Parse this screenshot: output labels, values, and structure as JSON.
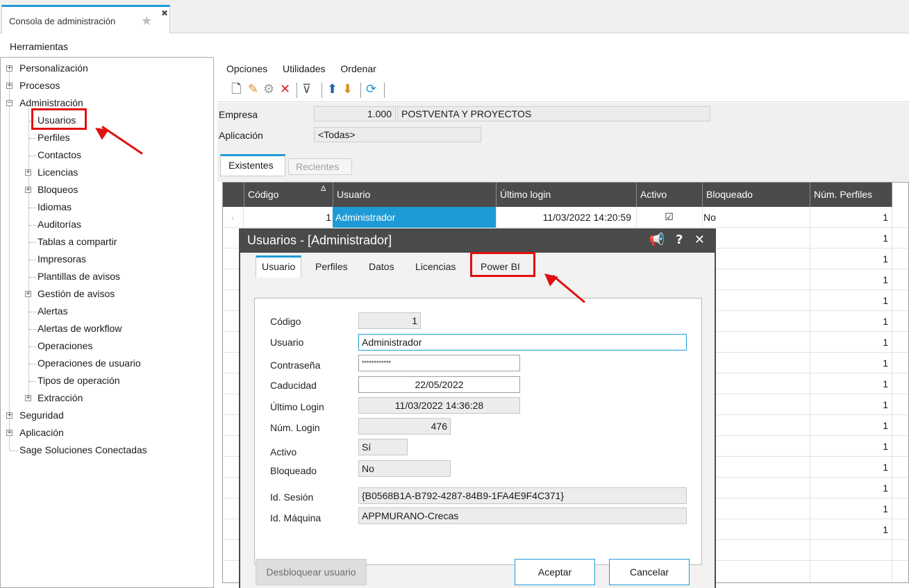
{
  "window_tab": {
    "title": "Consola de administración"
  },
  "top_menu": {
    "herramientas": "Herramientas"
  },
  "tree": {
    "items": [
      "Personalización",
      "Procesos",
      "Administración",
      "Usuarios",
      "Perfiles",
      "Contactos",
      "Licencias",
      "Bloqueos",
      "Idiomas",
      "Auditorías",
      "Tablas a compartir",
      "Impresoras",
      "Plantillas de avisos",
      "Gestión de avisos",
      "Alertas",
      "Alertas de workflow",
      "Operaciones",
      "Operaciones de usuario",
      "Tipos de operación",
      "Extracción",
      "Seguridad",
      "Aplicación",
      "Sage Soluciones Conectadas"
    ]
  },
  "main_menu": {
    "opciones": "Opciones",
    "utilidades": "Utilidades",
    "ordenar": "Ordenar"
  },
  "filters": {
    "empresa_label": "Empresa",
    "empresa_code": "1.000",
    "empresa_name": "POSTVENTA Y PROYECTOS",
    "aplicacion_label": "Aplicación",
    "aplicacion_value": "<Todas>"
  },
  "list_tabs": {
    "existentes": "Existentes",
    "recientes": "Recientes"
  },
  "grid": {
    "columns": [
      "Código",
      "Usuario",
      "Último login",
      "Activo",
      "Bloqueado",
      "Núm. Perfiles"
    ],
    "sort_indicator": "Δ",
    "first_row": {
      "codigo": "1",
      "usuario": "Administrador",
      "ultimo_login": "11/03/2022 14:20:59",
      "activo": "☑",
      "bloqueado": "No",
      "num_perfiles": "1"
    },
    "extra_perfiles": [
      "1",
      "1",
      "1",
      "1",
      "1",
      "1",
      "1",
      "1",
      "1",
      "1",
      "1",
      "1",
      "1",
      "1",
      "1"
    ]
  },
  "dialog": {
    "title": "Usuarios - [Administrador]",
    "tabs": [
      "Usuario",
      "Perfiles",
      "Datos",
      "Licencias",
      "Power BI"
    ],
    "labels": {
      "codigo": "Código",
      "usuario": "Usuario",
      "contrasena": "Contraseña",
      "caducidad": "Caducidad",
      "ultimo_login": "Último Login",
      "num_login": "Núm. Login",
      "activo": "Activo",
      "bloqueado": "Bloqueado",
      "id_sesion": "Id. Sesión",
      "id_maquina": "Id. Máquina"
    },
    "values": {
      "codigo": "1",
      "usuario": "Administrador",
      "contrasena": "************",
      "caducidad": "22/05/2022",
      "ultimo_login": "11/03/2022 14:36:28",
      "num_login": "476",
      "activo": "Sí",
      "bloqueado": "No",
      "id_sesion": "{B0568B1A-B792-4287-84B9-1FA4E9F4C371}",
      "id_maquina": "APPMURANO-Crecas"
    },
    "buttons": {
      "desbloquear": "Desbloquear usuario",
      "aceptar": "Aceptar",
      "cancelar": "Cancelar"
    }
  },
  "colors": {
    "accent": "#1e9bd7",
    "highlight_red": "#e01010",
    "grid_header": "#4b4b4b",
    "selected_cell": "#1e9bd7"
  }
}
